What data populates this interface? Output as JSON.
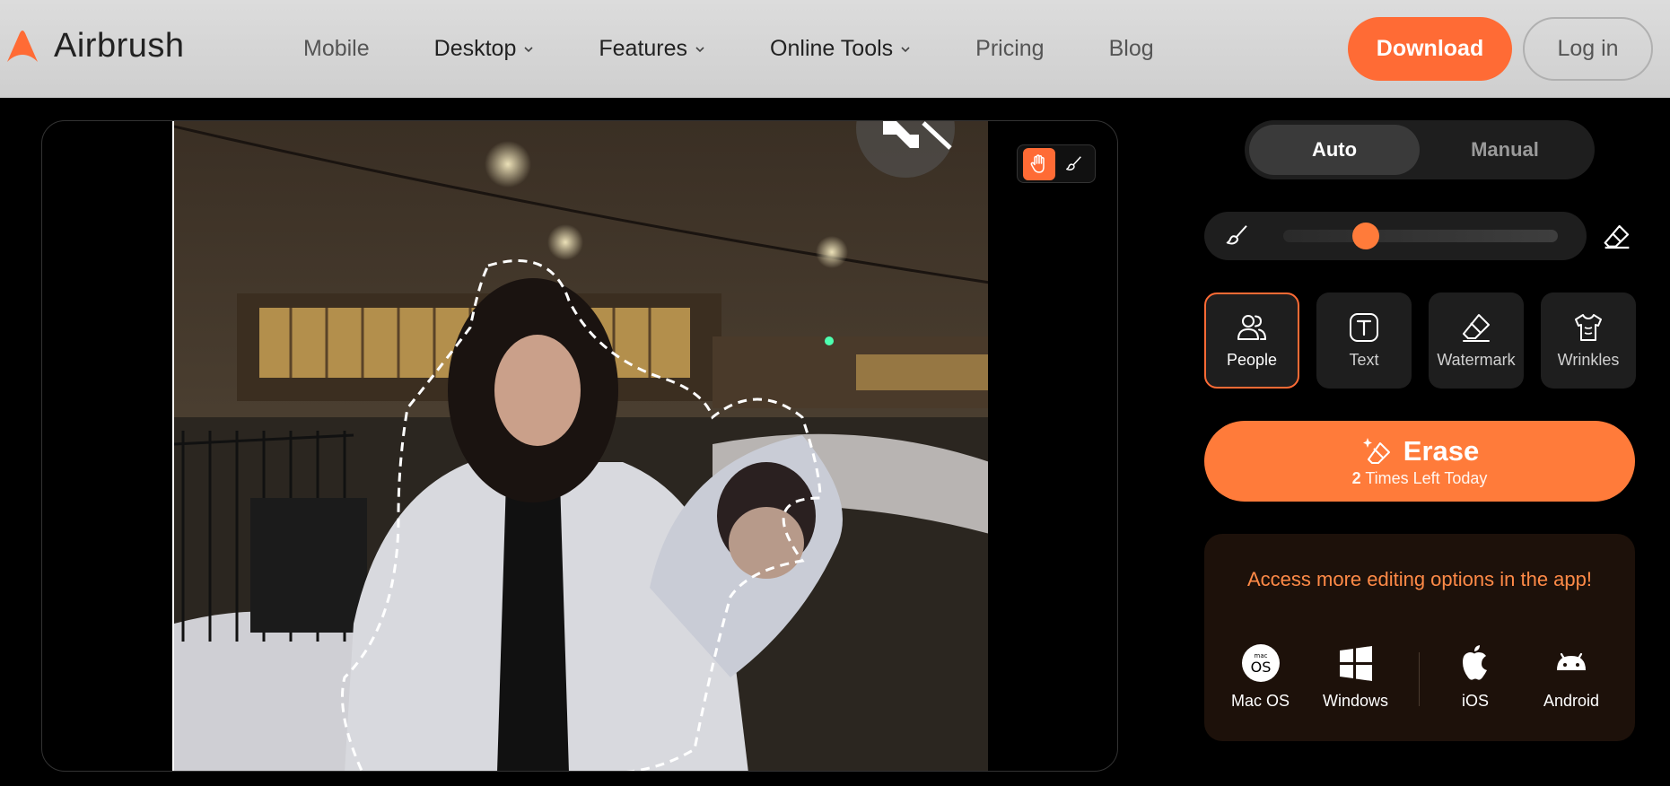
{
  "nav": {
    "brand": "Airbrush",
    "links": [
      {
        "label": "Mobile",
        "dropdown": false
      },
      {
        "label": "Desktop",
        "dropdown": true
      },
      {
        "label": "Features",
        "dropdown": true
      },
      {
        "label": "Online Tools",
        "dropdown": true
      },
      {
        "label": "Pricing",
        "dropdown": false
      },
      {
        "label": "Blog",
        "dropdown": false
      }
    ],
    "download_label": "Download",
    "login_label": "Log in"
  },
  "editor": {
    "tools": [
      "hand-icon",
      "brush-icon"
    ],
    "active_tool": "hand-icon"
  },
  "panel": {
    "modes": [
      "Auto",
      "Manual"
    ],
    "active_mode": "Auto",
    "brush_size_fraction": 0.3,
    "categories": [
      {
        "label": "People",
        "icon": "people-icon"
      },
      {
        "label": "Text",
        "icon": "text-icon"
      },
      {
        "label": "Watermark",
        "icon": "eraser-icon"
      },
      {
        "label": "Wrinkles",
        "icon": "shirt-icon"
      }
    ],
    "active_category": "People",
    "erase_label": "Erase",
    "erase_count": "2",
    "erase_sub": "Times Left Today",
    "promo_text": "Access more editing options in the app!",
    "platforms": [
      {
        "label": "Mac OS",
        "icon": "macos-icon"
      },
      {
        "label": "Windows",
        "icon": "windows-icon"
      },
      {
        "label": "iOS",
        "icon": "apple-icon"
      },
      {
        "label": "Android",
        "icon": "android-icon"
      }
    ]
  },
  "colors": {
    "accent": "#ff6b35",
    "panel_bg": "#1e1e1e",
    "promo_bg": "#1d110a",
    "promo_text": "#ff8a47"
  }
}
